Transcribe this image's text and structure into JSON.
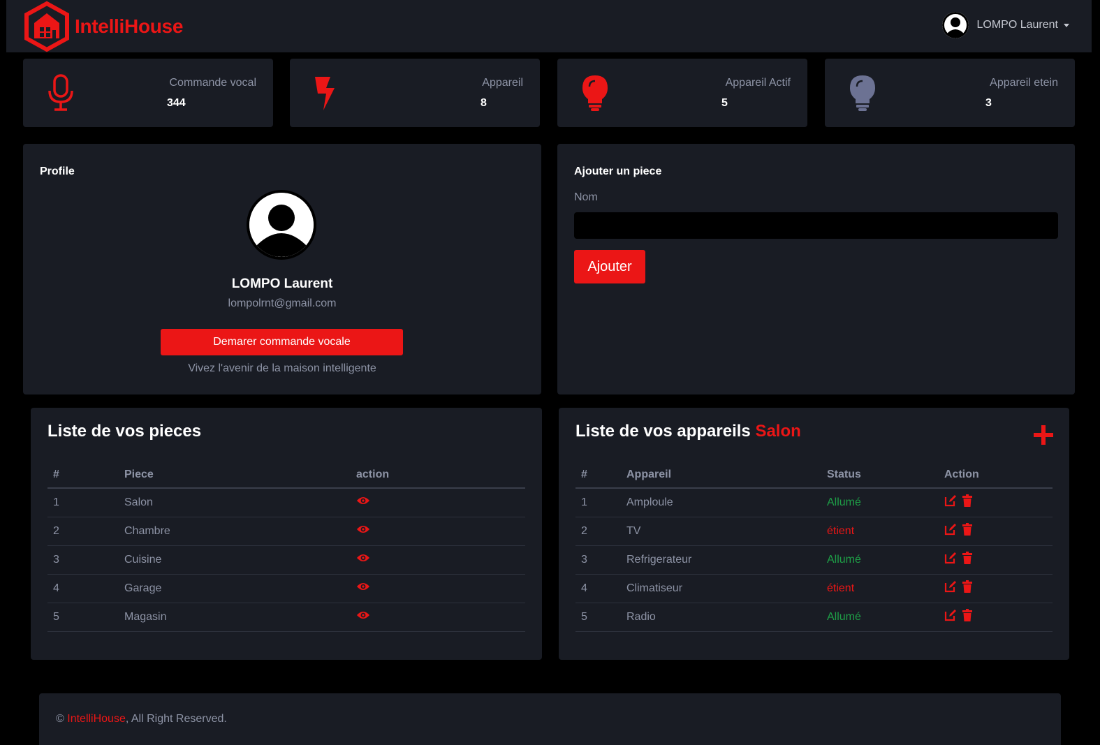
{
  "brand": {
    "name": "IntelliHouse",
    "accent_color": "#eb1616",
    "logo_icon": "house-hexagon-icon"
  },
  "navbar": {
    "user_name": "LOMPO Laurent",
    "avatar_icon": "user-avatar-icon"
  },
  "stats": [
    {
      "label": "Commande vocal",
      "value": "344",
      "icon": "microphone-icon",
      "icon_color": "#eb1616"
    },
    {
      "label": "Appareil",
      "value": "8",
      "icon": "bolt-icon",
      "icon_color": "#eb1616"
    },
    {
      "label": "Appareil Actif",
      "value": "5",
      "icon": "lightbulb-icon",
      "icon_color": "#eb1616"
    },
    {
      "label": "Appareil etein",
      "value": "3",
      "icon": "lightbulb-off-icon",
      "icon_color": "#6c7293"
    }
  ],
  "profile": {
    "title": "Profile",
    "name": "LOMPO Laurent",
    "email": "lompolrnt@gmail.com",
    "voice_button": "Demarer commande vocale",
    "tagline": "Vivez l'avenir de la maison intelligente"
  },
  "add_room": {
    "title": "Ajouter un piece",
    "name_label": "Nom",
    "name_value": "",
    "submit": "Ajouter"
  },
  "rooms": {
    "title": "Liste de vos pieces",
    "columns": [
      "#",
      "Piece",
      "action"
    ],
    "rows": [
      {
        "num": "1",
        "name": "Salon"
      },
      {
        "num": "2",
        "name": "Chambre"
      },
      {
        "num": "3",
        "name": "Cuisine"
      },
      {
        "num": "4",
        "name": "Garage"
      },
      {
        "num": "5",
        "name": "Magasin"
      }
    ]
  },
  "devices": {
    "title": "Liste de vos appareils",
    "room": "Salon",
    "columns": [
      "#",
      "Appareil",
      "Status",
      "Action"
    ],
    "rows": [
      {
        "num": "1",
        "name": "Amploule",
        "status": "Allumé",
        "on": true
      },
      {
        "num": "2",
        "name": "TV",
        "status": "étient",
        "on": false
      },
      {
        "num": "3",
        "name": "Refrigerateur",
        "status": "Allumé",
        "on": true
      },
      {
        "num": "4",
        "name": "Climatiseur",
        "status": "étient",
        "on": false
      },
      {
        "num": "5",
        "name": "Radio",
        "status": "Allumé",
        "on": true
      }
    ],
    "status_colors": {
      "on": "#1e9f47",
      "off": "#eb1616"
    }
  },
  "footer": {
    "copyright": "©",
    "brand": "IntelliHouse",
    "rest": ", All Right Reserved."
  }
}
